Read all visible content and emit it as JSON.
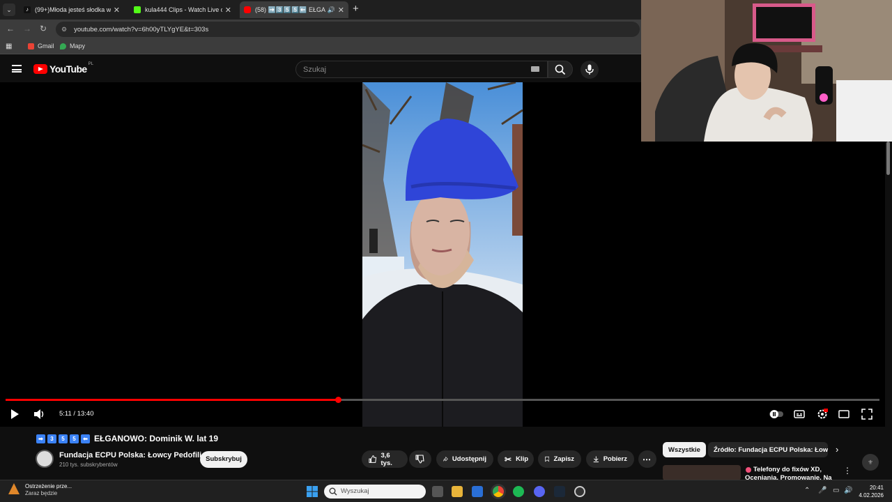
{
  "browser": {
    "tabs": [
      {
        "label": "(99+)Młoda jesteś słodka widzę",
        "icon": "tiktok-icon",
        "active": false
      },
      {
        "label": "kula444 Clips - Watch Live on K",
        "icon": "kick-icon",
        "active": false
      },
      {
        "label": "(58) ➡️3️⃣5️⃣5️⃣⬅️ EŁGANOW",
        "icon": "youtube-icon",
        "active": true
      }
    ],
    "url": "youtube.com/watch?v=6h00yTLYgYE&t=303s",
    "bookmarks": [
      {
        "label": "Gmail",
        "icon": "gmail-icon"
      },
      {
        "label": "Mapy",
        "icon": "maps-icon"
      }
    ]
  },
  "youtube": {
    "logo_text": "YouTube",
    "logo_region": "PL",
    "search_placeholder": "Szukaj"
  },
  "player": {
    "time": "5:11 / 13:40",
    "progress_fraction": 0.38
  },
  "video": {
    "title": "EŁGANOWO: Dominik W. lat 19",
    "title_emoji_numbers": [
      "3",
      "5",
      "5"
    ],
    "channel": "Fundacja ECPU Polska: Łowcy Pedofili",
    "subscribers": "210 tys. subskrybentów",
    "subscribe_label": "Subskrybuj",
    "likes": "3,6 tys.",
    "actions": {
      "share": "Udostępnij",
      "clip": "Klip",
      "save": "Zapisz",
      "download": "Pobierz"
    }
  },
  "sidebar": {
    "chips": [
      "Wszystkie",
      "Źródło: Fundacja ECPU Polska: Łowcy"
    ],
    "recommendation_title": "Telefony do fixów XD, Oceniania, Promowanie. Na"
  },
  "taskbar": {
    "notification_title": "Ostrzeżenie prze...",
    "notification_sub": "Zaraz będzie",
    "search_placeholder": "Wyszukaj",
    "time": "20:41",
    "date": "4.02.2026"
  },
  "colors": {
    "accent": "#ff0000",
    "background": "#0f0f0f"
  }
}
